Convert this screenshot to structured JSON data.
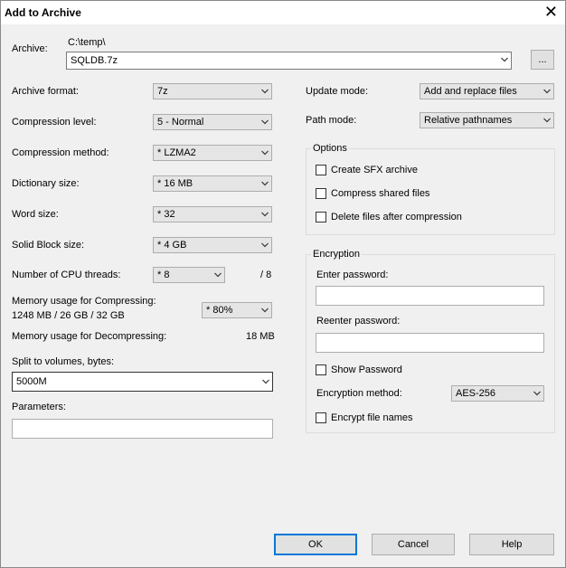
{
  "window": {
    "title": "Add to Archive",
    "close_glyph": "✕"
  },
  "archive": {
    "label": "Archive:",
    "path": "C:\\temp\\",
    "name": "SQLDB.7z",
    "browse_label": "..."
  },
  "left": {
    "archive_format": {
      "label": "Archive format:",
      "value": "7z"
    },
    "compression_level": {
      "label": "Compression level:",
      "value": "5 - Normal"
    },
    "compression_method": {
      "label": "Compression method:",
      "value": "*  LZMA2"
    },
    "dictionary_size": {
      "label": "Dictionary size:",
      "value": "*  16 MB"
    },
    "word_size": {
      "label": "Word size:",
      "value": "*  32"
    },
    "solid_block_size": {
      "label": "Solid Block size:",
      "value": "*  4 GB"
    },
    "cpu_threads": {
      "label": "Number of CPU threads:",
      "value": "*  8",
      "max": "/ 8"
    },
    "memory_compress": {
      "label": "Memory usage for Compressing:",
      "detail": "1248 MB / 26 GB / 32 GB",
      "value": "* 80%"
    },
    "memory_decompress": {
      "label": "Memory usage for Decompressing:",
      "value": "18 MB"
    },
    "split": {
      "label": "Split to volumes, bytes:",
      "value": "5000M"
    },
    "parameters": {
      "label": "Parameters:",
      "value": ""
    }
  },
  "right": {
    "update_mode": {
      "label": "Update mode:",
      "value": "Add and replace files"
    },
    "path_mode": {
      "label": "Path mode:",
      "value": "Relative pathnames"
    },
    "options": {
      "title": "Options",
      "create_sfx": "Create SFX archive",
      "compress_shared": "Compress shared files",
      "delete_after": "Delete files after compression"
    },
    "encryption": {
      "title": "Encryption",
      "enter_password": "Enter password:",
      "reenter_password": "Reenter password:",
      "show_password": "Show Password",
      "method_label": "Encryption method:",
      "method_value": "AES-256",
      "encrypt_names": "Encrypt file names"
    }
  },
  "buttons": {
    "ok": "OK",
    "cancel": "Cancel",
    "help": "Help"
  }
}
